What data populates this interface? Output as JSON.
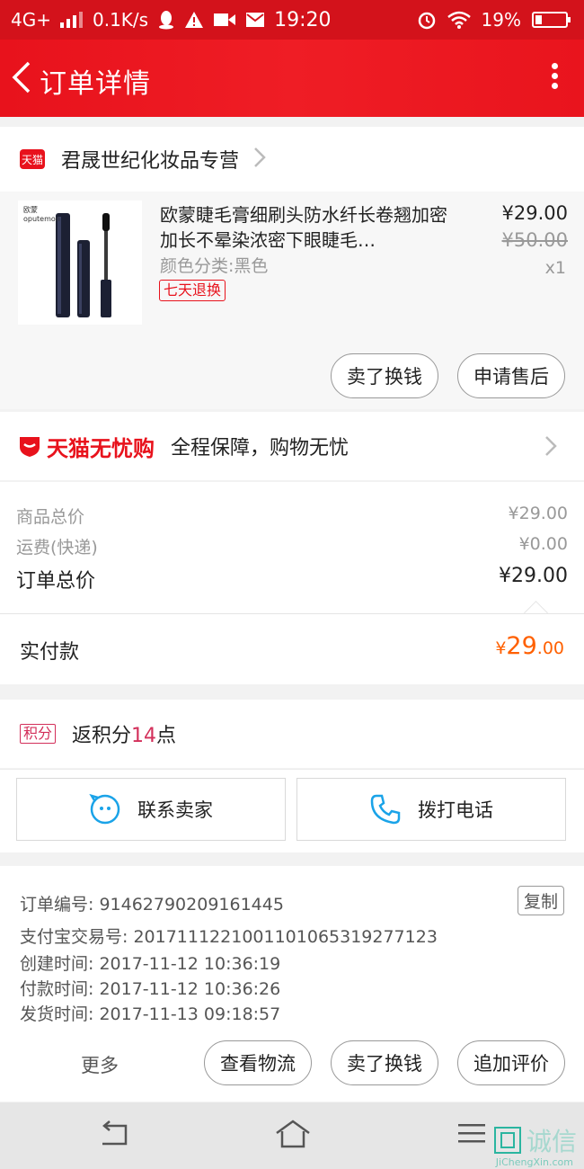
{
  "status_bar": {
    "network": "4G+",
    "speed": "0.1K/s",
    "time": "19:20",
    "battery": "19%"
  },
  "header": {
    "title": "订单详情"
  },
  "shop": {
    "badge": "天猫",
    "name": "君晟世纪化妆品专营"
  },
  "product": {
    "title": "欧蒙睫毛膏细刷头防水纤长卷翘加密加长不晕染浓密下眼睫毛…",
    "sku": "颜色分类:黑色",
    "tag": "七天退换",
    "price": "¥29.00",
    "original_price": "¥50.00",
    "quantity": "x1",
    "thumb_brand": "欧蒙",
    "thumb_brand_en": "oputemon",
    "buttons": [
      "卖了换钱",
      "申请售后"
    ]
  },
  "guarantee": {
    "logo": "天猫无忧购",
    "text": "全程保障，购物无忧"
  },
  "costs": {
    "rows": [
      {
        "label": "商品总价",
        "value": "¥29.00"
      },
      {
        "label": "运费(快递)",
        "value": "¥0.00"
      }
    ],
    "total_label": "订单总价",
    "total_value": "¥29.00"
  },
  "paid": {
    "label": "实付款",
    "yen": "¥",
    "int": "29",
    "dec": ".00"
  },
  "points": {
    "badge": "积分",
    "prefix": "返积分",
    "number": "14",
    "suffix": "点"
  },
  "contact": {
    "seller": "联系卖家",
    "phone": "拨打电话"
  },
  "order_info": {
    "rows": [
      "订单编号: 91462790209161445",
      "支付宝交易号: 2017111221001101065319277123",
      "创建时间: 2017-11-12 10:36:19",
      "付款时间: 2017-11-12 10:36:26",
      "发货时间: 2017-11-13 09:18:57"
    ],
    "copy": "复制"
  },
  "actions": {
    "more": "更多",
    "buttons": [
      "查看物流",
      "卖了换钱",
      "追加评价"
    ]
  },
  "watermark": {
    "text": "诚信",
    "sub": "JiChengXin.com"
  },
  "colors": {
    "brand_red": "#e8121c",
    "paid_orange": "#ff6000",
    "points_pink": "#d32f5a"
  }
}
